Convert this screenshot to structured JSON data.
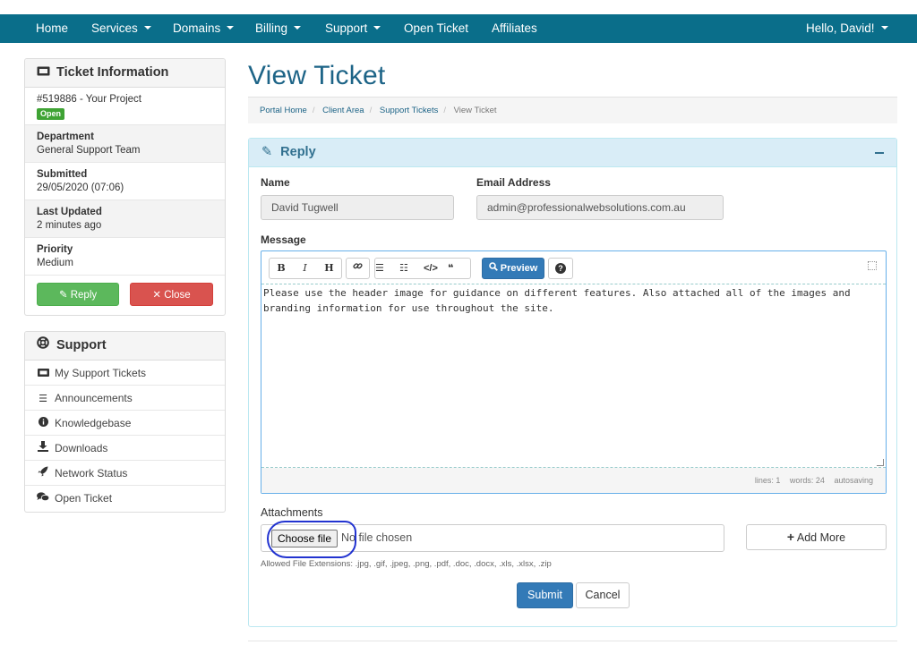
{
  "nav": {
    "home": "Home",
    "services": "Services",
    "domains": "Domains",
    "billing": "Billing",
    "support": "Support",
    "open_ticket": "Open Ticket",
    "affiliates": "Affiliates",
    "user_greeting": "Hello, David!"
  },
  "ticket_info": {
    "title": "Ticket Information",
    "ticket_ref": "#519886 - Your Project",
    "status": "Open",
    "department_label": "Department",
    "department_value": "General Support Team",
    "submitted_label": "Submitted",
    "submitted_value": "29/05/2020 (07:06)",
    "updated_label": "Last Updated",
    "updated_value": "2 minutes ago",
    "priority_label": "Priority",
    "priority_value": "Medium",
    "reply_button": "Reply",
    "close_button": "Close"
  },
  "support_menu": {
    "title": "Support",
    "items": [
      {
        "label": "My Support Tickets",
        "icon": "ticket-icon"
      },
      {
        "label": "Announcements",
        "icon": "list-icon"
      },
      {
        "label": "Knowledgebase",
        "icon": "info-icon"
      },
      {
        "label": "Downloads",
        "icon": "download-icon"
      },
      {
        "label": "Network Status",
        "icon": "rocket-icon"
      },
      {
        "label": "Open Ticket",
        "icon": "comments-icon"
      }
    ]
  },
  "page": {
    "title": "View Ticket",
    "breadcrumb": [
      "Portal Home",
      "Client Area",
      "Support Tickets",
      "View Ticket"
    ]
  },
  "reply": {
    "title": "Reply",
    "name_label": "Name",
    "name_value": "David Tugwell",
    "email_label": "Email Address",
    "email_value": "admin@professionalwebsolutions.com.au",
    "message_label": "Message",
    "toolbar": {
      "bold": "B",
      "italic": "I",
      "heading": "H",
      "preview": "Preview",
      "help": "?"
    },
    "message_text": "Please use the header image for guidance on different features. Also attached all of the images and branding information for use throughout the site.",
    "status": {
      "lines": "lines: 1",
      "words": "words: 24",
      "saving": "autosaving"
    },
    "attachments_label": "Attachments",
    "choose_file": "Choose file",
    "no_file": "No file chosen",
    "add_more": "Add More",
    "allowed_extensions": "Allowed File Extensions: .jpg, .gif, .jpeg, .png, .pdf, .doc, .docx, .xls, .xlsx, .zip",
    "submit": "Submit",
    "cancel": "Cancel"
  }
}
